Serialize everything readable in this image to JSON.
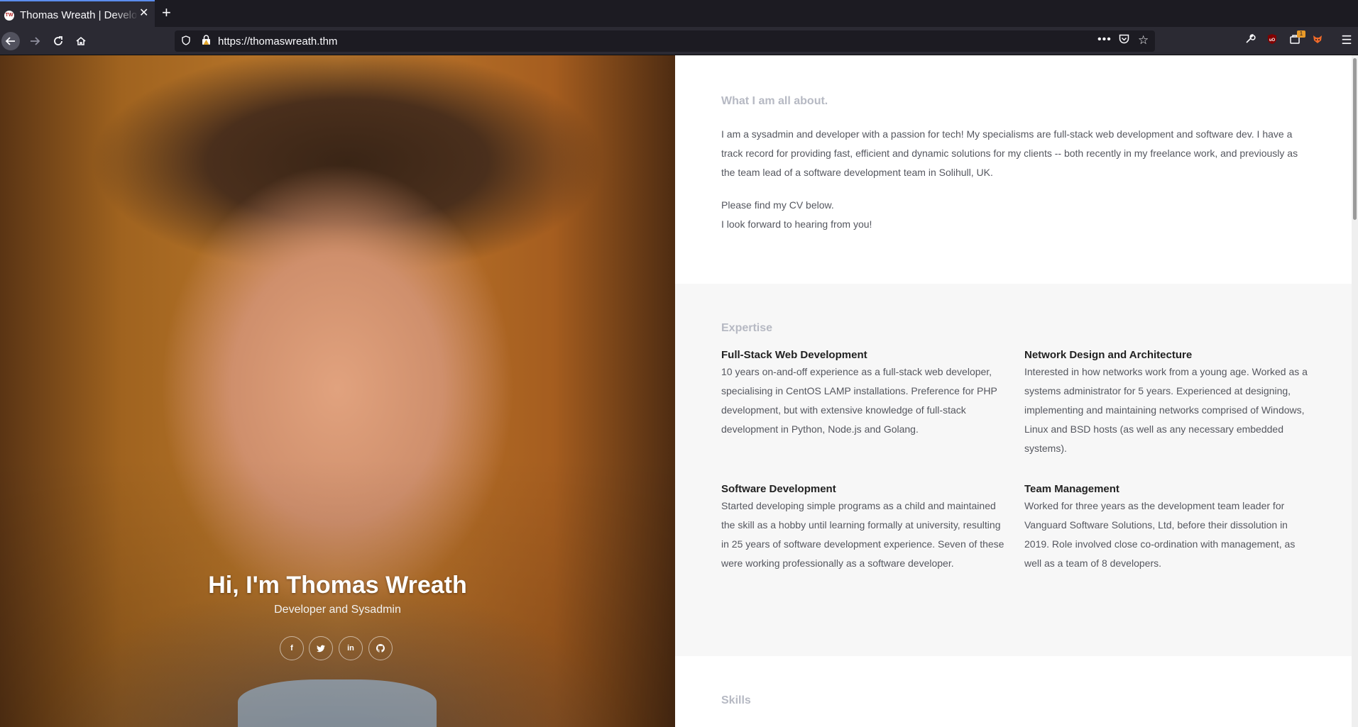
{
  "browser": {
    "tab_title": "Thomas Wreath | Developer",
    "favicon_text": "TW",
    "new_tab": "+",
    "close": "✕",
    "url": "https://thomaswreath.thm",
    "icons": {
      "back": "arrow-left-icon",
      "forward": "arrow-right-icon",
      "reload": "reload-icon",
      "home": "home-icon",
      "shield": "shield-icon",
      "lock": "lock-warning-icon",
      "more": "more-dots-icon",
      "pocket": "pocket-icon",
      "bookmark": "star-icon",
      "wrench": "wrench-icon",
      "ublock": "ublock-icon",
      "container": "container-icon",
      "fox": "foxyproxy-icon",
      "menu": "hamburger-icon"
    },
    "container_badge": "1"
  },
  "hero": {
    "title": "Hi, I'm Thomas Wreath",
    "subtitle": "Developer and Sysadmin",
    "social": [
      {
        "icon": "facebook-icon",
        "glyph": "f"
      },
      {
        "icon": "twitter-icon",
        "glyph": "t"
      },
      {
        "icon": "linkedin-icon",
        "glyph": "in"
      },
      {
        "icon": "github-icon",
        "glyph": "◎"
      }
    ]
  },
  "about": {
    "heading": "What I am all about.",
    "paragraph": "I am a sysadmin and developer with a passion for tech! My specialisms are full-stack web development and software dev. I have a track record for providing fast, efficient and dynamic solutions for my clients -- both recently in my freelance work, and previously as the team lead of a software development team in Solihull, UK.",
    "cv_line": "Please find my CV below.",
    "closing_line": "I look forward to hearing from you!"
  },
  "expertise": {
    "heading": "Expertise",
    "items": [
      {
        "title": "Full-Stack Web Development",
        "body": "10 years on-and-off experience as a full-stack web developer, specialising in CentOS LAMP installations. Preference for PHP development, but with extensive knowledge of full-stack development in Python, Node.js and Golang."
      },
      {
        "title": "Network Design and Architecture",
        "body": "Interested in how networks work from a young age. Worked as a systems administrator for 5 years. Experienced at designing, implementing and maintaining networks comprised of Windows, Linux and BSD hosts (as well as any necessary embedded systems)."
      },
      {
        "title": "Software Development",
        "body": "Started developing simple programs as a child and maintained the skill as a hobby until learning formally at university, resulting in 25 years of software development experience. Seven of these were working professionally as a software developer."
      },
      {
        "title": "Team Management",
        "body": "Worked for three years as the development team leader for Vanguard Software Solutions, Ltd, before their dissolution in 2019. Role involved close co-ordination with management, as well as a team of 8 developers."
      }
    ]
  },
  "skills": {
    "heading": "Skills"
  }
}
